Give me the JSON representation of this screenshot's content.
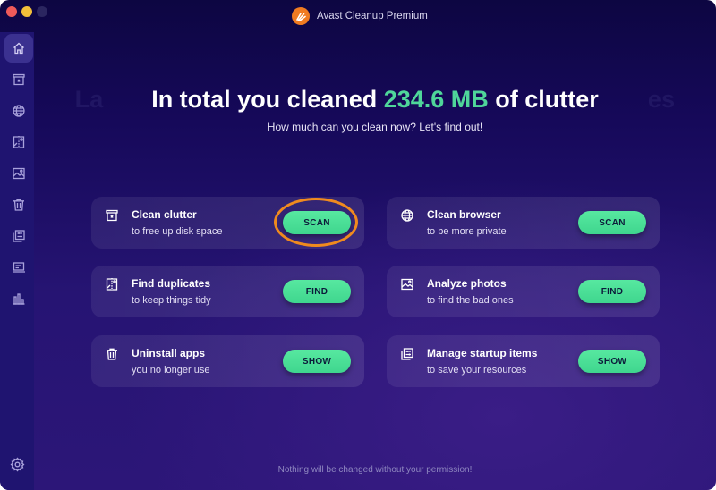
{
  "window": {
    "title": "Avast Cleanup Premium",
    "controls": [
      "close",
      "minimize",
      "zoom"
    ]
  },
  "sidebar": {
    "items": [
      {
        "id": "home",
        "icon": "home-icon",
        "active": true
      },
      {
        "id": "clean-clutter",
        "icon": "clutter-box-icon",
        "active": false
      },
      {
        "id": "browser",
        "icon": "globe-icon",
        "active": false
      },
      {
        "id": "duplicates",
        "icon": "duplicates-icon",
        "active": false
      },
      {
        "id": "photos",
        "icon": "photo-icon",
        "active": false
      },
      {
        "id": "uninstall",
        "icon": "trash-icon",
        "active": false
      },
      {
        "id": "startup",
        "icon": "startup-items-icon",
        "active": false
      },
      {
        "id": "system",
        "icon": "laptop-icon",
        "active": false
      },
      {
        "id": "stats",
        "icon": "bar-chart-icon",
        "active": false
      }
    ],
    "settings_icon": "gear-icon"
  },
  "main": {
    "ghost_text": "La                                                                               es",
    "headline_prefix": "In total you cleaned ",
    "headline_value": "234.6 MB",
    "headline_suffix": " of clutter",
    "subheadline": "How much can you clean now? Let's find out!",
    "cards": [
      {
        "title": "Clean clutter",
        "subtitle": "to free up disk space",
        "button": "SCAN",
        "icon": "clutter-box-icon",
        "highlighted": true
      },
      {
        "title": "Clean browser",
        "subtitle": "to be more private",
        "button": "SCAN",
        "icon": "globe-icon",
        "highlighted": false
      },
      {
        "title": "Find duplicates",
        "subtitle": "to keep things tidy",
        "button": "FIND",
        "icon": "duplicates-icon",
        "highlighted": false
      },
      {
        "title": "Analyze photos",
        "subtitle": "to find the bad ones",
        "button": "FIND",
        "icon": "photo-icon",
        "highlighted": false
      },
      {
        "title": "Uninstall apps",
        "subtitle": "you no longer use",
        "button": "SHOW",
        "icon": "trash-icon",
        "highlighted": false
      },
      {
        "title": "Manage startup items",
        "subtitle": "to save your resources",
        "button": "SHOW",
        "icon": "startup-items-icon",
        "highlighted": false
      }
    ],
    "footer_note": "Nothing will be changed without your permission!"
  },
  "colors": {
    "accent_green": "#4fd69a",
    "button_green": "#57e8a0",
    "highlight_orange": "#f08a1e",
    "brand_orange": "#f07b21"
  }
}
